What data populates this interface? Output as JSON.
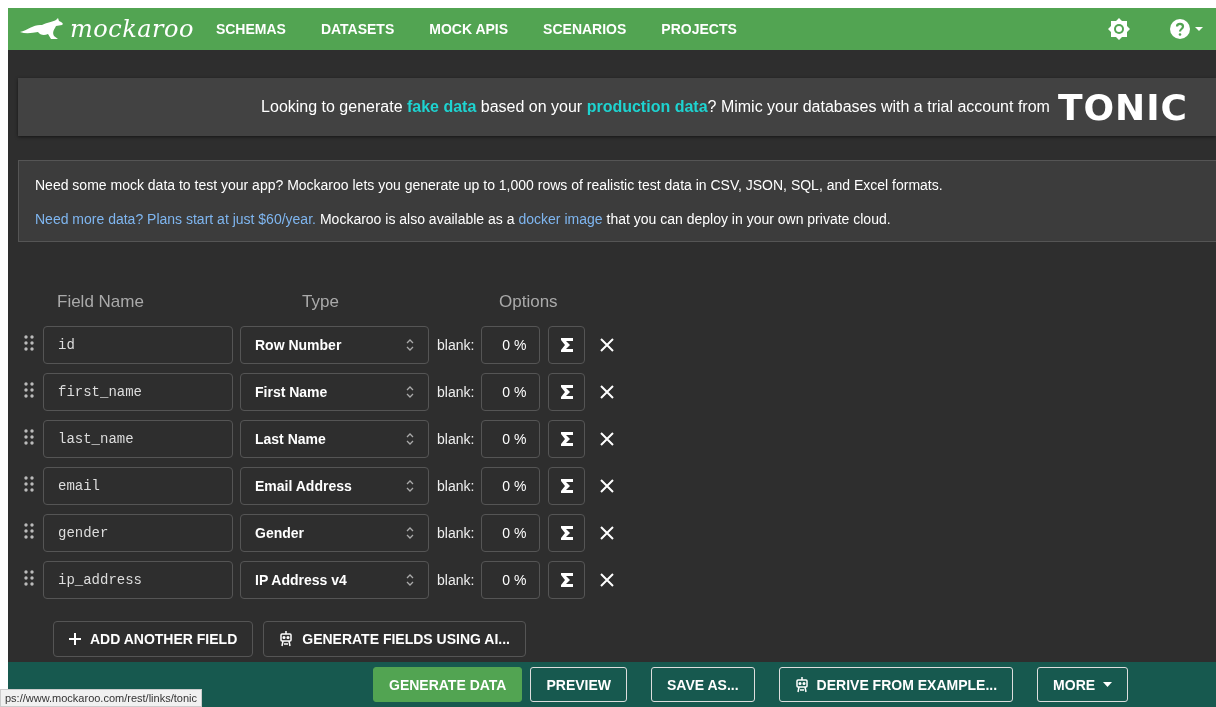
{
  "header": {
    "logo": "mockaroo",
    "nav": [
      {
        "label": "SCHEMAS"
      },
      {
        "label": "DATASETS"
      },
      {
        "label": "MOCK APIS"
      },
      {
        "label": "SCENARIOS"
      },
      {
        "label": "PROJECTS"
      }
    ]
  },
  "promo": {
    "text": "Looking to generate **fake data** based on your **production data**? Mimic your databases with a trial account from",
    "logo": "TONIC"
  },
  "info": {
    "line1": "Need some mock data to test your app? Mockaroo lets you generate up to 1,000 rows of realistic test data in CSV, JSON, SQL, and Excel formats.",
    "link1": "Need more data? Plans start at just $60/year.",
    "mid": "Mockaroo is also available as a",
    "link2": "docker image",
    "end": "that you can deploy in your own private cloud."
  },
  "columns": [
    "Field Name",
    "Type",
    "Options"
  ],
  "fields": [
    {
      "name": "id",
      "type": "Row Number",
      "blank_label": "blank:",
      "blank": "0 %"
    },
    {
      "name": "first_name",
      "type": "First Name",
      "blank_label": "blank:",
      "blank": "0 %"
    },
    {
      "name": "last_name",
      "type": "Last Name",
      "blank_label": "blank:",
      "blank": "0 %"
    },
    {
      "name": "email",
      "type": "Email Address",
      "blank_label": "blank:",
      "blank": "0 %"
    },
    {
      "name": "gender",
      "type": "Gender",
      "blank_label": "blank:",
      "blank": "0 %"
    },
    {
      "name": "ip_address",
      "type": "IP Address v4",
      "blank_label": "blank:",
      "blank": "0 %"
    }
  ],
  "field_actions": [
    {
      "label": "ADD ANOTHER FIELD",
      "kind": "plus"
    },
    {
      "label": "GENERATE FIELDS USING AI...",
      "kind": "robot"
    }
  ],
  "footer_buttons": [
    {
      "label": "GENERATE DATA",
      "kind": "primary"
    },
    {
      "label": "PREVIEW",
      "kind": "outline"
    },
    {
      "label": "SAVE AS...",
      "kind": "outline"
    },
    {
      "label": "DERIVE FROM EXAMPLE...",
      "kind": "robot"
    },
    {
      "label": "MORE",
      "kind": "menu"
    }
  ],
  "status_url": "ps://www.mockaroo.com/rest/links/tonic"
}
